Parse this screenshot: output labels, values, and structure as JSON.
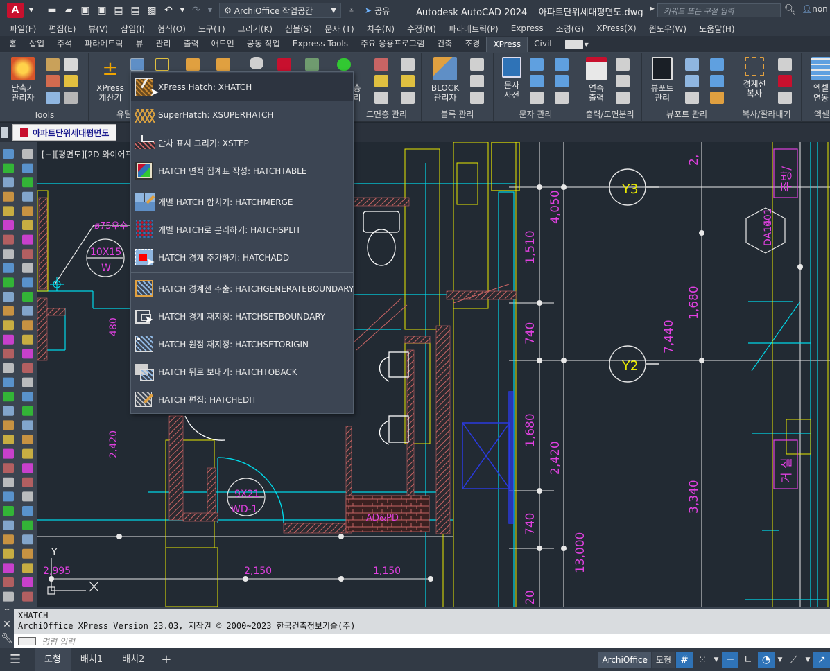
{
  "titlebar": {
    "logo_letter": "A",
    "workspace": "ArchiOffice 작업공간",
    "share": "공유",
    "app_name": "Autodesk AutoCAD 2024",
    "document": "아파트단위세대평면도.dwg",
    "search_placeholder": "키워드 또는 구절 입력",
    "user": "non"
  },
  "menubar": [
    "파일(F)",
    "편집(E)",
    "뷰(V)",
    "삽입(I)",
    "형식(O)",
    "도구(T)",
    "그리기(K)",
    "심볼(S)",
    "문자 (T)",
    "치수(N)",
    "수정(M)",
    "파라메트릭(P)",
    "Express",
    "조경(G)",
    "XPress(X)",
    "윈도우(W)",
    "도움말(H)"
  ],
  "ribbon_tabs": [
    "홈",
    "삽입",
    "주석",
    "파라메트릭",
    "뷰",
    "관리",
    "출력",
    "애드인",
    "공동 작업",
    "Express Tools",
    "주요 응용프로그램",
    "건축",
    "조경",
    "XPress",
    "Civil"
  ],
  "ribbon_active": "XPress",
  "ribbon_panels": {
    "tools_title": "Tools",
    "tools_btn1": "단축키",
    "tools_btn1b": "관리자",
    "tools_btn2": "XPress",
    "tools_btn2b": "계산기",
    "hatch_title": "유틸",
    "layer_title": "도면층 관리",
    "layer_btn_a": "층",
    "layer_btn_b": "리",
    "block_btn": "BLOCK",
    "block_btn_b": "관리자",
    "block_title": "블록 관리",
    "text_btn": "문자",
    "text_btn_b": "사전",
    "text_title": "문자 관리",
    "plot_btn": "연속",
    "plot_btn_b": "출력",
    "plot_title": "출력/도면분리",
    "viewport_btn": "뷰포트",
    "viewport_btn_b": "관리",
    "viewport_title": "뷰포트 관리",
    "copy_btn": "경계선",
    "copy_btn_b": "복사",
    "copy_title": "복사/잘라내기",
    "excel_btn": "엑셀",
    "excel_btn_b": "연동",
    "excel_title": "엑셀"
  },
  "doc_tab": "아파트단위세대평면도",
  "viewport_label": "[−][평면도][2D 와이어프",
  "dropdown": [
    {
      "label": "XPress Hatch: XHATCH",
      "icon": "xhatch-icon"
    },
    {
      "label": "SuperHatch: XSUPERHATCH",
      "icon": "superhatch-icon"
    },
    {
      "label": "단차 표시 그리기: XSTEP",
      "icon": "step-icon"
    },
    {
      "label": "HATCH 면적 집계표 작성: HATCHTABLE",
      "icon": "hatch-table-icon"
    },
    {
      "label": "개별 HATCH 합치기: HATCHMERGE",
      "icon": "hatch-merge-icon"
    },
    {
      "label": "개별 HATCH로 분리하기: HATCHSPLIT",
      "icon": "hatch-split-icon"
    },
    {
      "label": "HATCH 경계 추가하기: HATCHADD",
      "icon": "hatch-add-icon"
    },
    {
      "label": "HATCH 경계선 추출: HATCHGENERATEBOUNDARY",
      "icon": "hatch-boundary-icon"
    },
    {
      "label": "HATCH 경계 재지정: HATCHSETBOUNDARY",
      "icon": "hatch-setboundary-icon"
    },
    {
      "label": "HATCH 원점 재지정: HATCHSETORIGIN",
      "icon": "hatch-origin-icon"
    },
    {
      "label": "HATCH 뒤로 보내기: HATCHTOBACK",
      "icon": "hatch-toback-icon"
    },
    {
      "label": "HATCH 편집: HATCHEDIT",
      "icon": "hatch-edit-icon"
    }
  ],
  "drawing": {
    "dim_v": [
      "4,050",
      "1,510",
      "740",
      "1,680",
      "2,420",
      "740",
      "13,000",
      "20",
      "7,440",
      "1,680",
      "3,340",
      "2,420",
      "480"
    ],
    "dim_h": [
      "2,995",
      "2,150",
      "1,150"
    ],
    "grid": [
      "Y3",
      "Y2"
    ],
    "tags": [
      "10X15",
      "W",
      "9X21",
      "WD-1",
      "DA14",
      "001",
      "AD&PD"
    ],
    "room": [
      "거 실",
      "주방/"
    ],
    "pipe": "ø75우수",
    "axis": "Y"
  },
  "command": {
    "line1": "XHATCH",
    "line2": "ArchiOffice XPress Version 23.03, 저작권 © 2000~2023 한국건축정보기술(주)",
    "placeholder": "명령 입력"
  },
  "status": {
    "tabs": [
      "모형",
      "배치1",
      "배치2"
    ],
    "plus": "+",
    "archioffice": "ArchiOffice",
    "model": "모형"
  },
  "colors": {
    "accent": "#2f73b7",
    "dim_magenta": "#e040e0",
    "cyan": "#00d8e8",
    "yellow": "#e8e800",
    "hatch_red": "#c86464"
  }
}
